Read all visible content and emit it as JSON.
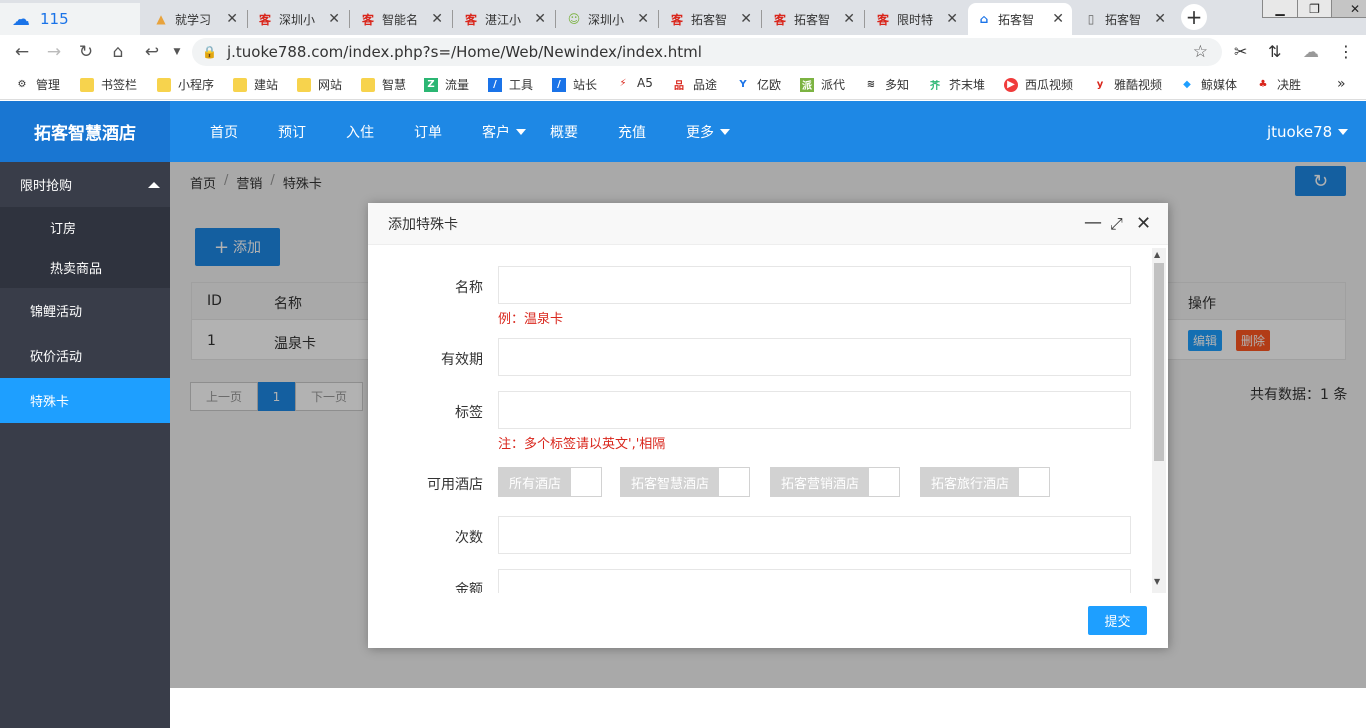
{
  "browser": {
    "tabs": [
      {
        "title": "115",
        "icon": "cloud-icon"
      },
      {
        "title": "就学习",
        "icon": "book-icon"
      },
      {
        "title": "深圳小",
        "icon": "ke-icon"
      },
      {
        "title": "智能名",
        "icon": "ke-icon"
      },
      {
        "title": "湛江小",
        "icon": "ke-icon"
      },
      {
        "title": "深圳小",
        "icon": "face-icon"
      },
      {
        "title": "拓客智",
        "icon": "ke-icon"
      },
      {
        "title": "拓客智",
        "icon": "ke-icon"
      },
      {
        "title": "限时特",
        "icon": "ke-icon"
      },
      {
        "title": "拓客智",
        "icon": "home-icon",
        "active": true
      },
      {
        "title": "拓客智",
        "icon": "page-icon"
      }
    ],
    "url": "j.tuoke788.com/index.php?s=/Home/Web/Newindex/index.html",
    "bookmarks": [
      {
        "label": "管理",
        "icon": "gear-icon"
      },
      {
        "label": "书签栏",
        "icon": "folder-icon"
      },
      {
        "label": "小程序",
        "icon": "folder-icon"
      },
      {
        "label": "建站",
        "icon": "folder-icon"
      },
      {
        "label": "网站",
        "icon": "folder-icon"
      },
      {
        "label": "智慧",
        "icon": "folder-icon"
      },
      {
        "label": "流量",
        "icon": "site-icon"
      },
      {
        "label": "工具",
        "icon": "site-icon"
      },
      {
        "label": "站长",
        "icon": "site-icon"
      },
      {
        "label": "A5",
        "icon": "site-icon"
      },
      {
        "label": "品途",
        "icon": "site-icon"
      },
      {
        "label": "亿欧",
        "icon": "site-icon"
      },
      {
        "label": "派代",
        "icon": "site-icon"
      },
      {
        "label": "多知",
        "icon": "site-icon"
      },
      {
        "label": "芥末堆",
        "icon": "site-icon"
      },
      {
        "label": "西瓜视频",
        "icon": "site-icon"
      },
      {
        "label": "雅酷视频",
        "icon": "site-icon"
      },
      {
        "label": "鲸媒体",
        "icon": "site-icon"
      },
      {
        "label": "决胜",
        "icon": "site-icon"
      }
    ],
    "bookmarks_more": "»"
  },
  "app": {
    "logo": "拓客智慧酒店",
    "menu": [
      "首页",
      "预订",
      "入住",
      "订单",
      "客户",
      "概要",
      "充值",
      "更多"
    ],
    "user": "jtuoke78"
  },
  "sidebar": {
    "group": "限时抢购",
    "sub_items": [
      "订房",
      "热卖商品"
    ],
    "items": [
      "锦鲤活动",
      "砍价活动",
      "特殊卡"
    ],
    "active": "特殊卡"
  },
  "breadcrumb": [
    "首页",
    "营销",
    "特殊卡"
  ],
  "toolbar": {
    "add_label": "添加"
  },
  "table": {
    "headers": {
      "id": "ID",
      "name": "名称",
      "ops": "操作"
    },
    "rows": [
      {
        "id": "1",
        "name": "温泉卡",
        "edit": "编辑",
        "delete": "删除"
      }
    ]
  },
  "pagination": {
    "prev": "上一页",
    "current": "1",
    "next": "下一页",
    "total": "共有数据：1 条"
  },
  "modal": {
    "title": "添加特殊卡",
    "fields": {
      "name": {
        "label": "名称",
        "hint": "例：温泉卡",
        "value": ""
      },
      "validity": {
        "label": "有效期",
        "value": ""
      },
      "tags": {
        "label": "标签",
        "hint": "注：多个标签请以英文','相隔",
        "value": ""
      },
      "hotels": {
        "label": "可用酒店",
        "options": [
          "所有酒店",
          "拓客智慧酒店",
          "拓客营销酒店",
          "拓客旅行酒店"
        ]
      },
      "count": {
        "label": "次数",
        "value": ""
      },
      "amount": {
        "label": "金额",
        "value": ""
      }
    },
    "submit_label": "提交"
  },
  "colors": {
    "primary": "#1e88e5",
    "sidebar": "#393d49",
    "danger": "#ff5722",
    "submit": "#1e9fff"
  }
}
